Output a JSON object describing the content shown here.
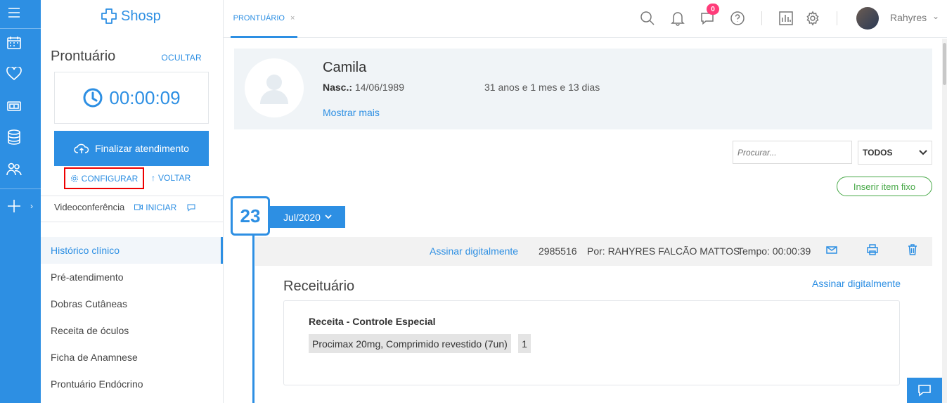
{
  "app": {
    "logo_text": "Shosp"
  },
  "rail": {
    "items": [
      "menu-icon",
      "calendar-icon",
      "heart-icon",
      "money-icon",
      "database-icon",
      "users-icon",
      "plus-icon"
    ]
  },
  "panel": {
    "title": "Prontuário",
    "hide_label": "OCULTAR",
    "timer": "00:00:09",
    "finish_label": "Finalizar atendimento",
    "config_label": "CONFIGURAR",
    "back_label": "VOLTAR",
    "video_label": "Videoconferência",
    "video_start_label": "INICIAR",
    "menu": [
      {
        "label": "Histórico clínico",
        "active": true
      },
      {
        "label": "Pré-atendimento"
      },
      {
        "label": "Dobras Cutâneas"
      },
      {
        "label": "Receita de óculos"
      },
      {
        "label": "Ficha de Anamnese"
      },
      {
        "label": "Prontuário Endócrino"
      }
    ]
  },
  "topbar": {
    "tab_label": "PRONTUÁRIO",
    "tab_close": "×",
    "messages_badge": "0",
    "user_name": "Rahyres"
  },
  "patient": {
    "name": "Camila",
    "birth_label": "Nasc.:",
    "birth_date": "14/06/1989",
    "age": "31 anos e 1 mes e 13 dias",
    "show_more": "Mostrar mais"
  },
  "filters": {
    "search_placeholder": "Procurar...",
    "select_value": "TODOS",
    "insert_label": "Inserir item fixo"
  },
  "timeline": {
    "day": "23",
    "month": "Jul/2020"
  },
  "entry": {
    "sign_label": "Assinar digitalmente",
    "id": "2985516",
    "author": "Por: RAHYRES FALCÃO MATTOS",
    "time": "Tempo: 00:00:39",
    "section_title": "Receituário",
    "section_sign": "Assinar digitalmente",
    "rx_type": "Receita - Controle Especial",
    "medication": "Procimax 20mg, Comprimido revestido (7un)",
    "quantity": "1"
  },
  "colors": {
    "accent": "#2d8fe3",
    "success": "#46a846",
    "badge": "#ff3c7a",
    "highlight": "#e00000"
  }
}
